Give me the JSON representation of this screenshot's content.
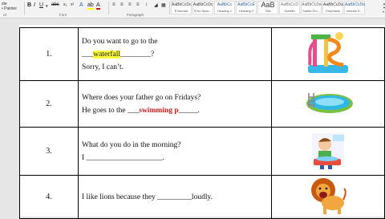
{
  "ribbon": {
    "clipboard_lines": [
      "ste",
      "• Painter"
    ],
    "clipboard_group": "rd",
    "font_group": "Font",
    "paragraph_group": "Paragraph",
    "styles": [
      {
        "sample": "AaBbCcDc",
        "name": "¶ Normal"
      },
      {
        "sample": "AaBbCcDc",
        "name": "¶ No Spac..."
      },
      {
        "sample": "AaBbCc",
        "name": "Heading 1"
      },
      {
        "sample": "AaBbCcE",
        "name": "Heading 2"
      },
      {
        "sample": "AaB",
        "name": "Title"
      },
      {
        "sample": "AaBbCcD",
        "name": "Subtitle"
      },
      {
        "sample": "AaBbCcDa",
        "name": "Subtle Em..."
      },
      {
        "sample": "AaBbCcDa",
        "name": "Emphasis"
      },
      {
        "sample": "AaBbCcDa",
        "name": "Intense E..."
      }
    ]
  },
  "rows": [
    {
      "number": "1.",
      "line1": "Do you want to go to the",
      "line2_pre": "___",
      "line2_answer": "waterfall",
      "line2_post": "________?",
      "line3": "Sorry, I can’t.",
      "image": "waterpark-slide"
    },
    {
      "number": "2.",
      "line1": "Where does your father go on Fridays?",
      "line2_pre": "He goes to the ___",
      "line2_answer": "swimming p",
      "line2_post": "_____.",
      "image": "swimming-pool"
    },
    {
      "number": "3.",
      "line1": "What do you do in the morning?",
      "line2_pre": "I ____________________.",
      "image": "boy-washing-face"
    },
    {
      "number": "4.",
      "line1": "I like lions because they _________loudly.",
      "image": "roaring-lion"
    }
  ]
}
